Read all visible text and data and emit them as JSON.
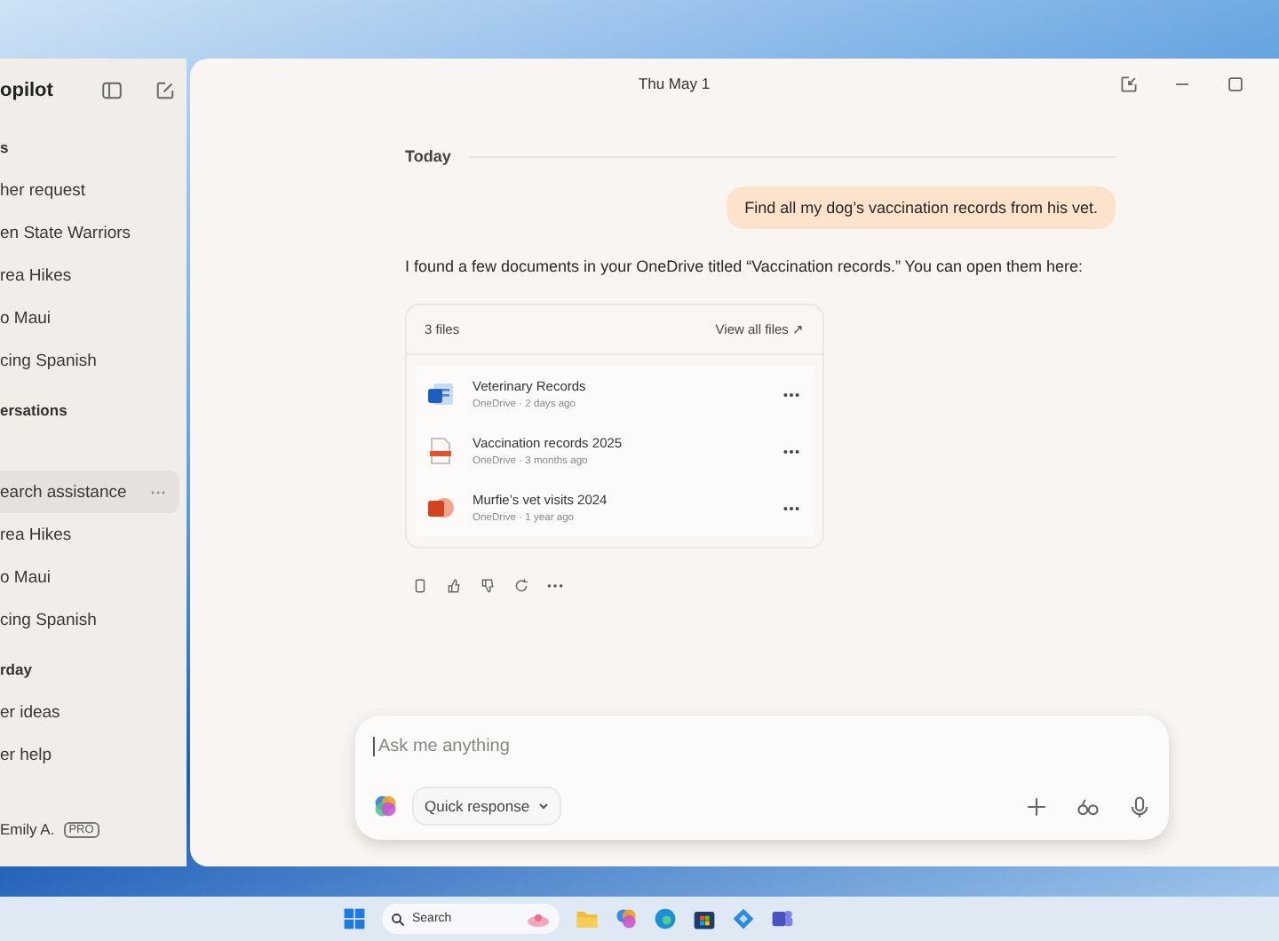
{
  "sidebar": {
    "app_name": "opilot",
    "sections": [
      {
        "heading": "s",
        "items": [
          {
            "label": "her request",
            "selected": false
          },
          {
            "label": "en State Warriors",
            "selected": false
          },
          {
            "label": "rea Hikes",
            "selected": false
          },
          {
            "label": "o Maui",
            "selected": false
          },
          {
            "label": "cing Spanish",
            "selected": false
          }
        ]
      },
      {
        "heading": "ersations",
        "items": [
          {
            "label": "earch assistance",
            "selected": true
          },
          {
            "label": "rea Hikes",
            "selected": false
          },
          {
            "label": "o Maui",
            "selected": false
          },
          {
            "label": "cing Spanish",
            "selected": false
          }
        ]
      },
      {
        "heading": "rday",
        "items": [
          {
            "label": "er ideas",
            "selected": false
          },
          {
            "label": "er help",
            "selected": false
          }
        ]
      }
    ],
    "user": {
      "name": "Emily A.",
      "badge": "PRO"
    }
  },
  "top_bar": {
    "date": "Thu May 1"
  },
  "chat": {
    "day_label": "Today",
    "user_message": "Find all my dog’s vaccination records from his vet.",
    "reply": "I found a few documents in your OneDrive titled “Vaccination records.” You can open them here:",
    "files_card": {
      "count": "3 files",
      "view_all": "View all files ↗",
      "files": [
        {
          "name": "Veterinary Records",
          "meta": "OneDrive · 2 days ago",
          "kind": "word"
        },
        {
          "name": "Vaccination records 2025",
          "meta": "OneDrive · 3 months ago",
          "kind": "pdf"
        },
        {
          "name": "Murfie’s vet visits 2024",
          "meta": "OneDrive · 1 year ago",
          "kind": "powerpoint"
        }
      ]
    }
  },
  "composer": {
    "placeholder": "Ask me anything",
    "mode": "Quick response"
  },
  "taskbar": {
    "search_placeholder": "Search"
  }
}
